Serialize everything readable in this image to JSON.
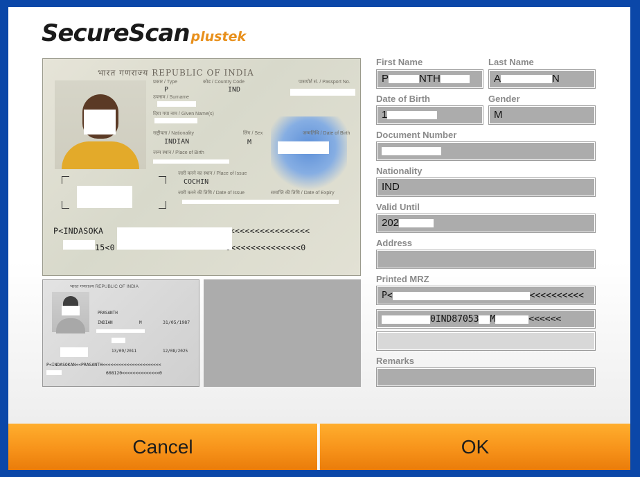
{
  "logo": {
    "main": "SecureScan",
    "sub": "plustek"
  },
  "passport_main": {
    "header": "भारत गणराज्य  REPUBLIC OF INDIA",
    "type_label": "प्रकार / Type",
    "type_value": "P",
    "country_label": "कोड / Country Code",
    "country_value": "IND",
    "passport_no_label": "पासपोर्ट सं. / Passport No.",
    "surname_label": "उपनाम / Surname",
    "given_label": "दिया गया नाम / Given Name(s)",
    "nationality_label": "राष्ट्रीयता / Nationality",
    "nationality_value": "INDIAN",
    "sex_label": "लिंग / Sex",
    "sex_value": "M",
    "dob_label": "जन्मतिथि / Date of Birth",
    "pob_label": "जन्म स्थान / Place of Birth",
    "poi_label": "जारी करने का स्थान / Place of Issue",
    "poi_value": "COCHIN",
    "doi_label": "जारी करने की तिथि / Date of Issue",
    "doe_label": "समाप्ति की तिथि / Date of Expiry",
    "mrz1": "P<INDASOKA",
    "mrz1_tail": "<<<<<<<<<<<<<<<<<<<<<<<",
    "mrz2": "15<0",
    "mrz2_tail": "0<<<<<<<<<<<<<<0"
  },
  "passport_small": {
    "header": "भारत गणराज्य  REPUBLIC OF INDIA",
    "given_value": "PRASANTH",
    "nationality_value": "INDIAN",
    "sex_value": "M",
    "dob_value": "31/05/1987",
    "doi_value": "13/09/2011",
    "doe_value": "12/08/2025",
    "mrz1": "P<INDASOKAN<<PRASANTH<<<<<<<<<<<<<<<<<<<<<<",
    "mrz2": "608120<<<<<<<<<<<<<<0"
  },
  "form": {
    "first_name_label": "First Name",
    "last_name_label": "Last Name",
    "first_name_value_a": "P",
    "first_name_value_b": "NTH",
    "last_name_value_a": "A",
    "last_name_value_b": "N",
    "dob_label": "Date of Birth",
    "dob_value_a": "1",
    "dob_value_b": "",
    "gender_label": "Gender",
    "gender_value": "M",
    "doc_number_label": "Document Number",
    "doc_number_value": "",
    "nationality_label": "Nationality",
    "nationality_value": "IND",
    "valid_until_label": "Valid Until",
    "valid_until_value": "202",
    "address_label": "Address",
    "address_value": "",
    "printed_mrz_label": "Printed MRZ",
    "mrz_line1_a": "P<",
    "mrz_line1_b": "<<<<<<<<<<",
    "mrz_line2_a": "",
    "mrz_line2_mid": "0IND8705",
    "mrz_line2_c": "3",
    "mrz_line2_d": "M",
    "mrz_line2_b": "<<<<<<",
    "mrz_line3": "",
    "remarks_label": "Remarks",
    "remarks_value": ""
  },
  "buttons": {
    "cancel": "Cancel",
    "ok": "OK"
  },
  "colors": {
    "frame_border": "#0b47a8",
    "button_orange": "#f7931a",
    "field_gray": "#acacac",
    "label_gray": "#8a8a8a"
  }
}
